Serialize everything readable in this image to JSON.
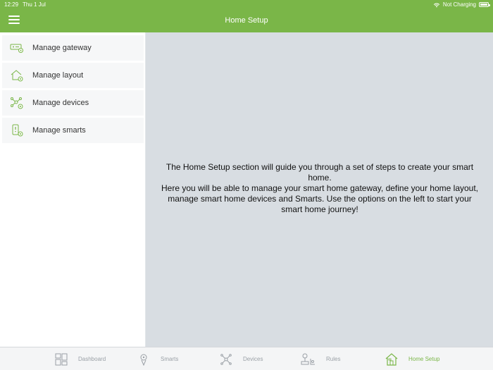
{
  "status_bar": {
    "time": "12:29",
    "date": "Thu 1 Jul",
    "charging": "Not Charging"
  },
  "header": {
    "title": "Home Setup",
    "color": "#7ab648"
  },
  "sidebar": {
    "items": [
      {
        "label": "Manage gateway",
        "icon": "gateway-icon"
      },
      {
        "label": "Manage layout",
        "icon": "house-settings-icon"
      },
      {
        "label": "Manage devices",
        "icon": "devices-hub-icon"
      },
      {
        "label": "Manage smarts",
        "icon": "smarts-remote-icon"
      }
    ]
  },
  "main": {
    "intro_line1": "The Home Setup section will guide you through a set of steps to create your smart home.",
    "intro_line2": "Here you will be able to manage your smart home gateway, define your home layout, manage smart home devices and Smarts. Use the options on the left to start your smart home journey!"
  },
  "tabs": [
    {
      "label": "Dashboard",
      "icon": "dashboard-grid-icon",
      "active": false
    },
    {
      "label": "Smarts",
      "icon": "smarts-pin-icon",
      "active": false
    },
    {
      "label": "Devices",
      "icon": "devices-icon",
      "active": false
    },
    {
      "label": "Rules",
      "icon": "rules-icon",
      "active": false
    },
    {
      "label": "Home Setup",
      "icon": "home-setup-icon",
      "active": true
    }
  ],
  "colors": {
    "accent": "#7ab648",
    "inactive": "#9aa0a6",
    "content_bg": "#d8dde2"
  }
}
